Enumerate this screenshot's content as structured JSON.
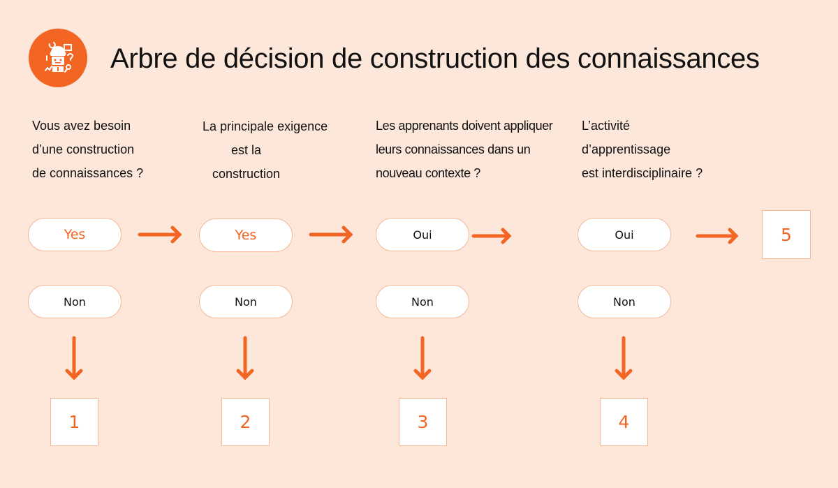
{
  "header": {
    "logo_icon": "brain-robot-icon",
    "title": "Arbre de décision de construction des connaissances"
  },
  "colors": {
    "accent": "#f26522",
    "background": "#fde7da",
    "border": "#f6b894"
  },
  "questions": [
    {
      "lines": [
        "Vous avez besoin",
        "d’une construction",
        "de connaissances ?"
      ]
    },
    {
      "lines": [
        "La principale exigence",
        "est la",
        "construction"
      ]
    },
    {
      "lines": [
        "Les apprenants doivent appliquer",
        "leurs connaissances dans un",
        "nouveau contexte ?"
      ]
    },
    {
      "lines": [
        "L’activité",
        "d’apprentissage",
        "est interdisciplinaire ?"
      ]
    }
  ],
  "yes_buttons": [
    "Yes",
    "Yes",
    "Oui",
    "Oui"
  ],
  "no_buttons": [
    "Non",
    "Non",
    "Non",
    "Non"
  ],
  "outcomes": [
    "1",
    "2",
    "3",
    "4",
    "5"
  ]
}
